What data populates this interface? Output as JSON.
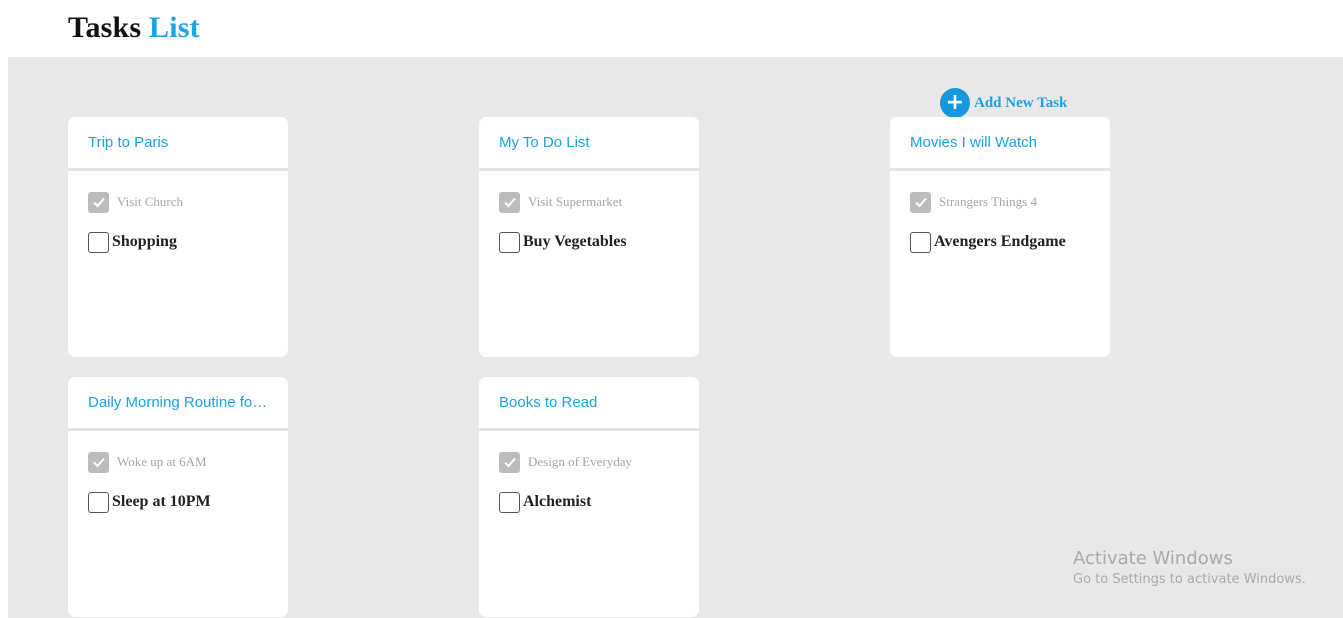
{
  "header": {
    "title_main": "Tasks",
    "title_accent": "List"
  },
  "add_task": {
    "icon": "plus-circle-icon",
    "label": "Add New Task"
  },
  "colors": {
    "accent": "#1aa3e6",
    "board_bg": "#e8e8e8",
    "checked_box": "#bcbcbc"
  },
  "cards": [
    {
      "title": "Trip to Paris",
      "tasks": [
        {
          "label": "Visit Church",
          "done": true
        },
        {
          "label": "Shopping",
          "done": false
        }
      ]
    },
    {
      "title": "My To Do List",
      "tasks": [
        {
          "label": "Visit Supermarket",
          "done": true
        },
        {
          "label": "Buy Vegetables",
          "done": false
        }
      ]
    },
    {
      "title": "Movies I will Watch",
      "tasks": [
        {
          "label": "Strangers Things 4",
          "done": true
        },
        {
          "label": "Avengers Endgame",
          "done": false
        }
      ]
    },
    {
      "title": "Daily Morning Routine for...",
      "tasks": [
        {
          "label": "Woke up at 6AM",
          "done": true
        },
        {
          "label": "Sleep at 10PM",
          "done": false
        }
      ]
    },
    {
      "title": "Books to Read",
      "tasks": [
        {
          "label": "Design of Everyday",
          "done": true
        },
        {
          "label": "Alchemist",
          "done": false
        }
      ]
    }
  ],
  "watermark": {
    "title": "Activate Windows",
    "subtitle": "Go to Settings to activate Windows."
  }
}
